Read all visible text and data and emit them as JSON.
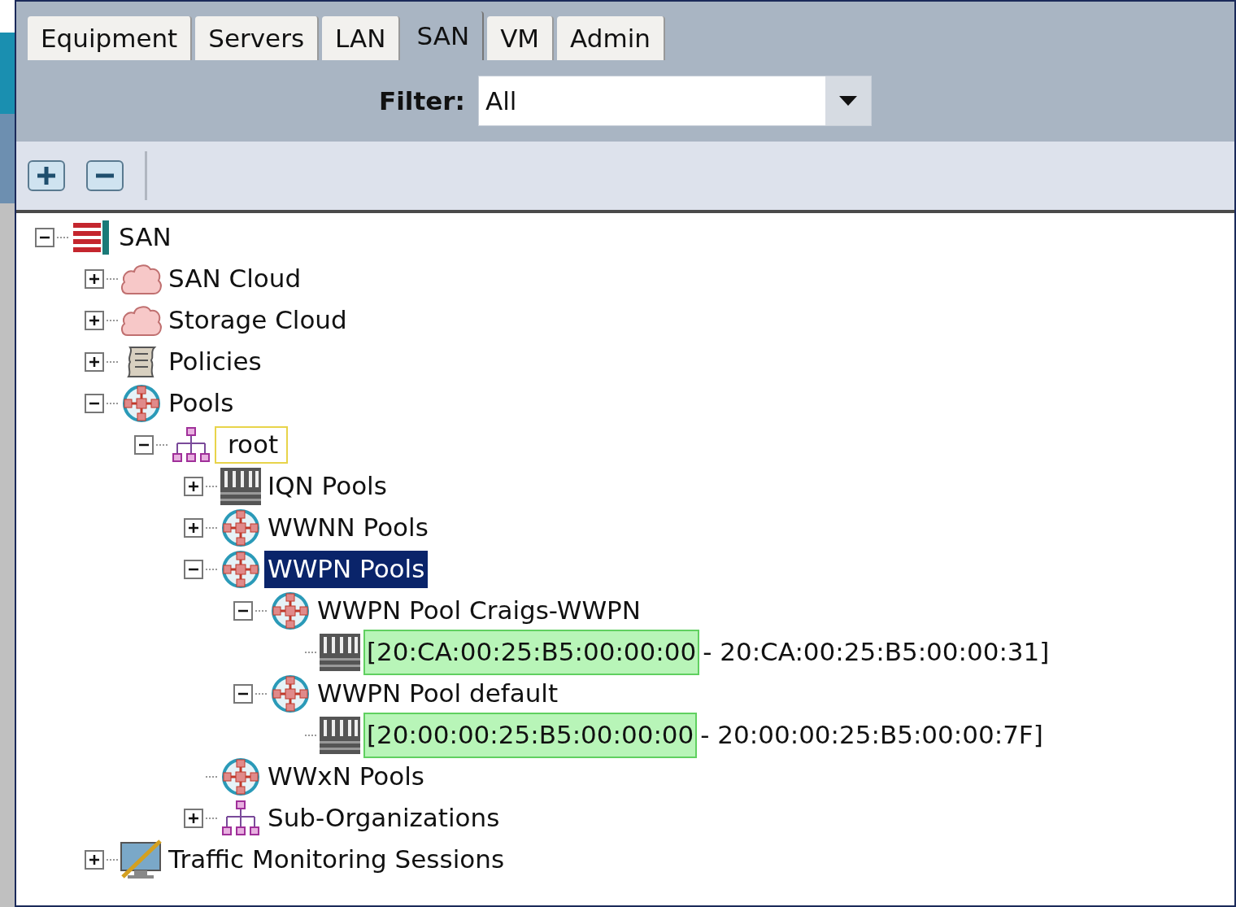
{
  "tabs": [
    {
      "label": "Equipment",
      "selected": false
    },
    {
      "label": "Servers",
      "selected": false
    },
    {
      "label": "LAN",
      "selected": false
    },
    {
      "label": "SAN",
      "selected": true
    },
    {
      "label": "VM",
      "selected": false
    },
    {
      "label": "Admin",
      "selected": false
    }
  ],
  "filter": {
    "label": "Filter:",
    "value": "All"
  },
  "tree": [
    {
      "label": "SAN",
      "kind": "san",
      "expanded": true,
      "selected": false,
      "focused": false,
      "children": [
        {
          "label": "SAN Cloud",
          "kind": "cloud",
          "expanded": false,
          "selected": false,
          "focused": false
        },
        {
          "label": "Storage Cloud",
          "kind": "cloud",
          "expanded": false,
          "selected": false,
          "focused": false
        },
        {
          "label": "Policies",
          "kind": "policy",
          "expanded": false,
          "selected": false,
          "focused": false
        },
        {
          "label": "Pools",
          "kind": "pool",
          "expanded": true,
          "selected": false,
          "focused": false,
          "children": [
            {
              "label": "root",
              "kind": "org",
              "expanded": true,
              "selected": false,
              "focused": true,
              "children": [
                {
                  "label": "IQN Pools",
                  "kind": "block",
                  "expanded": false,
                  "selected": false,
                  "focused": false
                },
                {
                  "label": "WWNN Pools",
                  "kind": "pool",
                  "expanded": false,
                  "selected": false,
                  "focused": false
                },
                {
                  "label": "WWPN Pools",
                  "kind": "pool",
                  "expanded": true,
                  "selected": true,
                  "focused": false,
                  "children": [
                    {
                      "label": "WWPN Pool Craigs-WWPN",
                      "kind": "pool",
                      "expanded": true,
                      "selected": false,
                      "focused": false,
                      "children": [
                        {
                          "highlight": "[20:CA:00:25:B5:00:00:00",
                          "label": "- 20:CA:00:25:B5:00:00:31]",
                          "kind": "block",
                          "selected": false,
                          "focused": false
                        }
                      ]
                    },
                    {
                      "label": "WWPN Pool default",
                      "kind": "pool",
                      "expanded": true,
                      "selected": false,
                      "focused": false,
                      "children": [
                        {
                          "highlight": "[20:00:00:25:B5:00:00:00",
                          "label": "- 20:00:00:25:B5:00:00:7F]",
                          "kind": "block",
                          "selected": false,
                          "focused": false
                        }
                      ]
                    }
                  ]
                },
                {
                  "label": "WWxN Pools",
                  "kind": "pool",
                  "selected": false,
                  "focused": false
                },
                {
                  "label": "Sub-Organizations",
                  "kind": "org",
                  "expanded": false,
                  "selected": false,
                  "focused": false
                }
              ]
            }
          ]
        },
        {
          "label": "Traffic Monitoring Sessions",
          "kind": "monitor",
          "expanded": false,
          "selected": false,
          "focused": false
        }
      ]
    }
  ]
}
